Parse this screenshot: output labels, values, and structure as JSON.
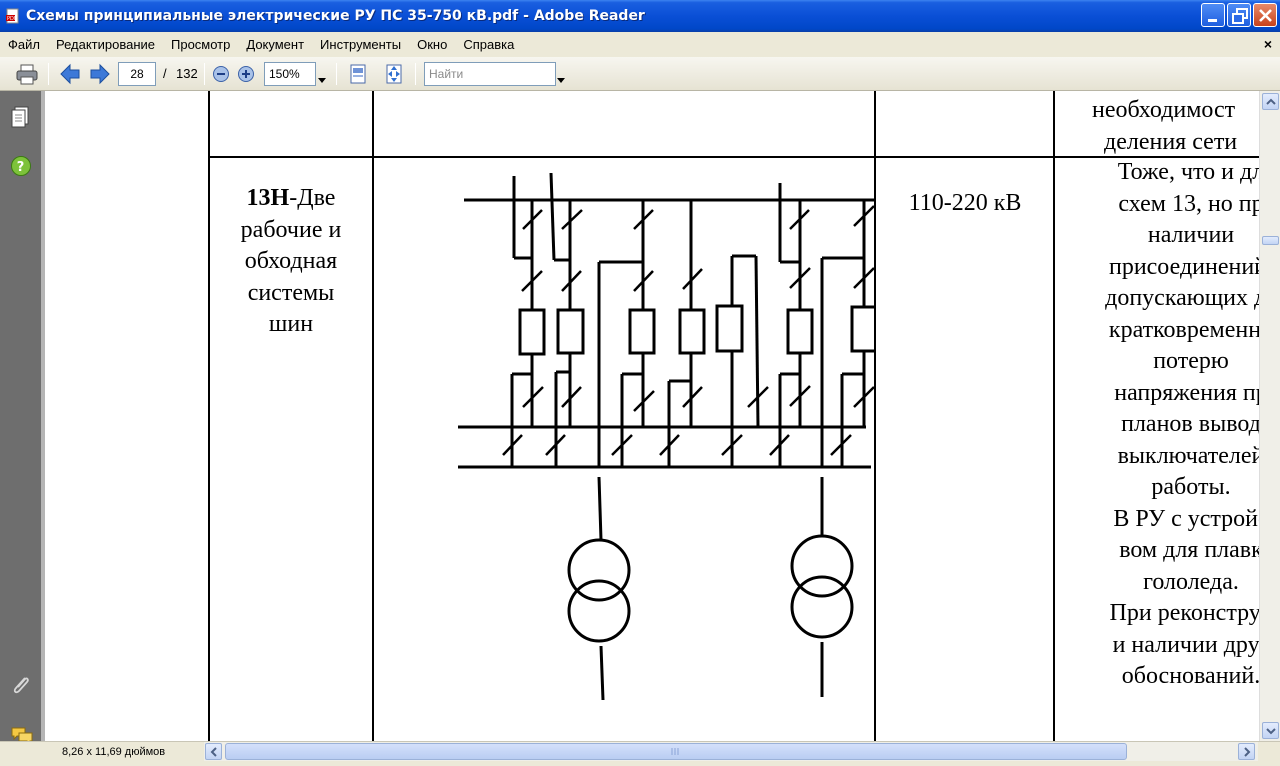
{
  "window": {
    "title": "Схемы принципиальные электрические РУ ПС 35-750 кВ.pdf - Adobe Reader",
    "controls": [
      "minimize",
      "maximize",
      "close"
    ]
  },
  "menu": {
    "items": [
      {
        "label": "Файл"
      },
      {
        "label": "Редактирование"
      },
      {
        "label": "Просмотр"
      },
      {
        "label": "Документ"
      },
      {
        "label": "Инструменты"
      },
      {
        "label": "Окно"
      },
      {
        "label": "Справка"
      }
    ],
    "close_glyph": "×"
  },
  "toolbar": {
    "page_current": "28",
    "page_separator": "/",
    "page_total": "132",
    "zoom": "150%",
    "search_placeholder": "Найти",
    "icons": [
      "print-icon",
      "previous-page-icon",
      "next-page-icon",
      "zoom-out-icon",
      "zoom-in-icon",
      "fit-page-icon",
      "fit-width-icon",
      "dropdown-arrow-icon"
    ]
  },
  "navigation_pane": {
    "icons": [
      "pages-icon",
      "help-icon",
      "attachments-icon",
      "comments-icon"
    ]
  },
  "document": {
    "prev_row_notes": [
      "необходимост",
      "деления сети"
    ],
    "row": {
      "scheme_code": "13Н",
      "scheme_name": "-Две рабочие и обходная системы шин",
      "scheme_name_lines": [
        "-Две",
        "рабочие и",
        "обходная",
        "системы",
        "шин"
      ],
      "voltage": "110-220 кВ",
      "notes_lines": [
        "Тоже, что и дл",
        "схем 13, но пр",
        "наличии",
        "присоединений,",
        "допускающих да",
        "кратковременну",
        "потерю",
        "напряжения пр",
        "планов вывод",
        "выключателей",
        "работы.",
        "В РУ с устройс",
        "вом для плавк",
        "гололеда.",
        "При реконструк",
        "и наличии друг",
        "обоснований."
      ]
    }
  },
  "statusbar": {
    "page_size": "8,26 x 11,69 дюймов"
  }
}
